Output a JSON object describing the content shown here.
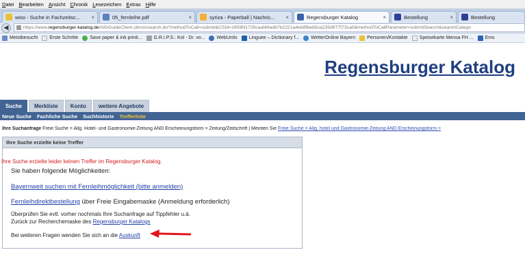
{
  "menu": [
    "Datei",
    "Bearbeiten",
    "Ansicht",
    "Chronik",
    "Lesezeichen",
    "Extras",
    "Hilfe"
  ],
  "tabs": [
    {
      "label": "wiso - Suche in Fachzeitsc...",
      "color": "#e8c23a",
      "active": false
    },
    {
      "label": "05_fernleihe.pdf",
      "color": "#5b7fbf",
      "active": false
    },
    {
      "label": "syriza - Paperball | Nachric...",
      "color": "#f2b134",
      "active": false
    },
    {
      "label": "Regensburger Katalog",
      "color": "#3a63a8",
      "active": true
    },
    {
      "label": "Bestellung",
      "color": "#2f3e9a",
      "active": false
    },
    {
      "label": "Bestellung",
      "color": "#2f3e9a",
      "active": false
    }
  ],
  "address": {
    "prefix": "https://www.",
    "domain": "regensburger-katalog.de",
    "rest": "/InfoGuideClient.ubrsis/search.do?methodToCall=submit&CSId=1659N1725caaf49adb7b2221a4eb8fbeb5ca235d877f73ca0&methodToCallParameter=submitSearch&searchCatego"
  },
  "bookmarks": [
    {
      "label": "Meistbesucht",
      "color": "#6b8dc4"
    },
    {
      "label": "Erste Schritte",
      "color": "#e9edf3"
    },
    {
      "label": "Save paper & ink printi...",
      "color": "#4caf50"
    },
    {
      "label": "G.R.I.P.S.: Kol - Dr. vo...",
      "color": "#9aa3ad"
    },
    {
      "label": "WebUntis",
      "color": "#3f6fb5"
    },
    {
      "label": "Linguee – Dictionary f...",
      "color": "#1d5fa8"
    },
    {
      "label": "WetterOnline Bayern",
      "color": "#3a83c9"
    },
    {
      "label": "Personen/Kontakte",
      "color": "#e8c23a"
    },
    {
      "label": "Speisekarte Mensa FH ...",
      "color": "#e9edf3"
    },
    {
      "label": "Ems",
      "color": "#2f62b0"
    }
  ],
  "site_title": "Regensburger Katalog",
  "nav_tabs": [
    "Suche",
    "Merkliste",
    "Konto",
    "weitere Angebote"
  ],
  "sub_nav": [
    "Neue Suche",
    "Fachliche Suche",
    "Suchhistorie",
    "Trefferliste"
  ],
  "query": {
    "label": "Ihre Suchanfrage",
    "text": "Freie Suche = Allg. Hotel- und Gastronomie-Zeitung AND Erscheinungsform = Zeitung/Zeitschrift | Meinten Sie",
    "suggestion": "Freie Suche = Allg. hotel und Gastronomie-Zeitung AND Erscheinungsform ="
  },
  "result": {
    "header": "Ihre Suche erzielte keine Treffer",
    "error": "Ihre Suche erzielte leider keinen Treffer im Regensburger Katalog.",
    "options_intro": "Sie haben folgende Möglichkeiten:",
    "bayernweit_link": "Bayernweit suchen mit Fernleihmöglichkeit (bitte anmelden)",
    "fernleih_link": "Fernleihdirektbestellung",
    "fernleih_text": "über Freie Eingabemaske (Anmeldung erforderlich)",
    "check_text": "Überprüfen Sie evtl. vorher nochmals Ihre Suchanfrage auf Tippfehler u.ä.",
    "back_text": "Zurück zur Recherchemaske des",
    "back_link": "Regensburger Katalogs",
    "help_text": "Bei weiteren Fragen wenden Sie sich an die",
    "help_link": "Auskunft"
  }
}
